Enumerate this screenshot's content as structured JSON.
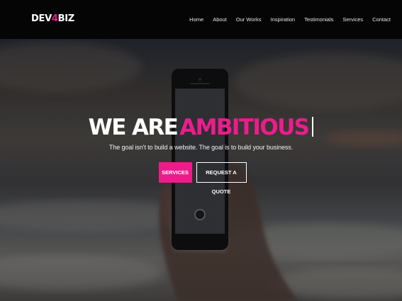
{
  "logo": {
    "prefix": "DEV",
    "accent": "4",
    "suffix": "BIZ"
  },
  "nav": [
    "Home",
    "About",
    "Our Works",
    "Inspiration",
    "Testimonials",
    "Services",
    "Contact"
  ],
  "hero": {
    "headline_white": "WE ARE",
    "headline_accent": "AMBITIOUS",
    "subtitle": "The goal isn't to build a website. The goal is to build your business.",
    "buttons": {
      "primary": "SERVICES",
      "secondary": "REQUEST A QUOTE"
    }
  },
  "colors": {
    "accent": "#ec1c8c",
    "navbar": "#050505",
    "text": "#ffffff"
  }
}
